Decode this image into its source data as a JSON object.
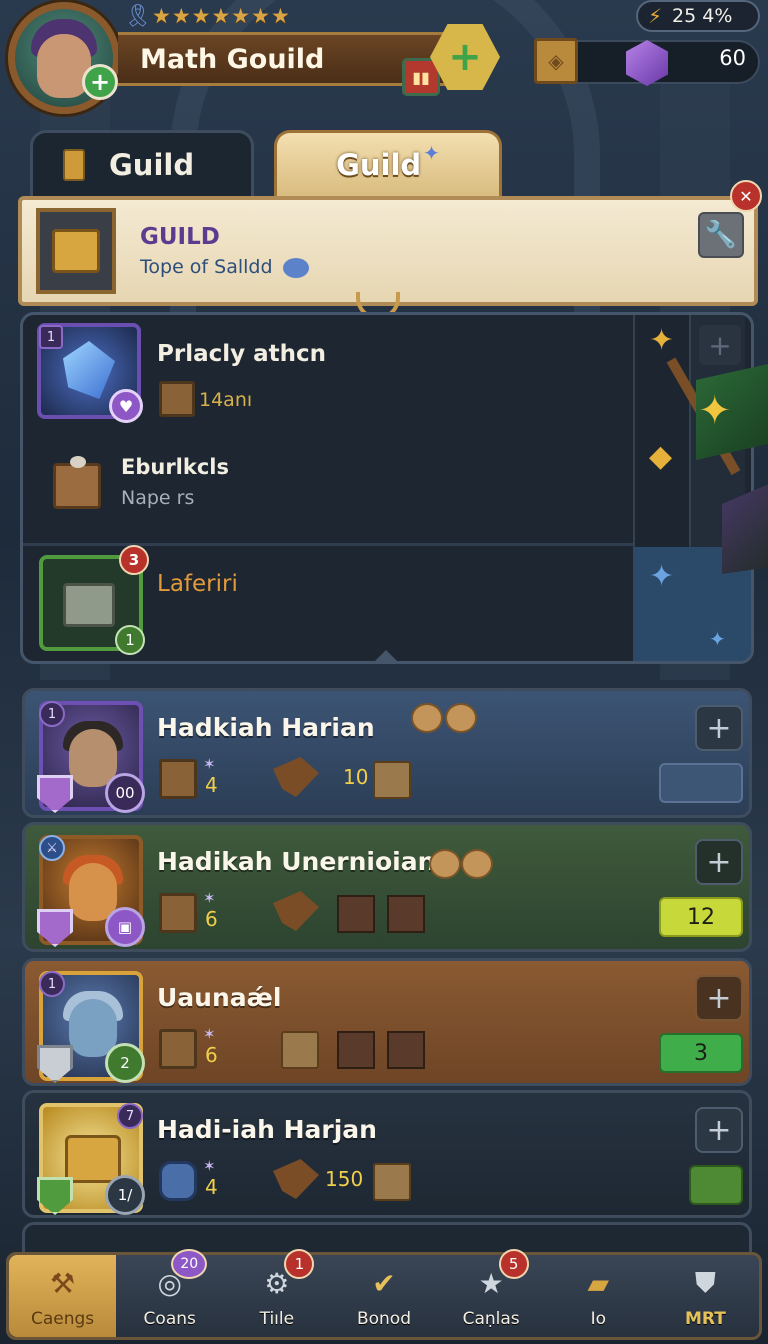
{
  "header": {
    "guild_title": "Math Gouild",
    "stars": "★★★★★★★",
    "timer": "25 4%",
    "gems": "60"
  },
  "tabs": [
    {
      "label": "Guild",
      "active": false
    },
    {
      "label": "Guild",
      "active": true
    }
  ],
  "banner": {
    "title": "GUILD",
    "subtitle": "Tope of Salldd"
  },
  "quests": [
    {
      "title": "Prlacly athcn",
      "sub": "14anı",
      "rank": "1"
    },
    {
      "title": "Eburlkcls",
      "sub": "Nape rs"
    },
    {
      "title": "Laferiri",
      "badge": "3",
      "level": "1"
    }
  ],
  "members": [
    {
      "name": "Hadkiah Harian",
      "rank": "1",
      "level": "00",
      "stat": "4",
      "tool_value": "10",
      "score": ""
    },
    {
      "name": "Hadikah Unernioiane",
      "rank": "",
      "level": "",
      "stat": "6",
      "tool_value": "",
      "score": "12",
      "score_color": "#c7d93a"
    },
    {
      "name": "Uaunaǽl",
      "rank": "1",
      "level": "2",
      "stat": "6",
      "tool_value": "",
      "score": "3",
      "score_color": "#3fae4a"
    },
    {
      "name": "Hadi-iah Harjan",
      "rank": "7",
      "level": "1/",
      "stat": "4",
      "tool_value": "150",
      "score": "",
      "score_color": "#4e8a33"
    }
  ],
  "nav": [
    {
      "label": "Caengs",
      "icon": "hammer-icon",
      "active": true
    },
    {
      "label": "Coans",
      "icon": "coin-icon",
      "badge": "20"
    },
    {
      "label": "Tiıle",
      "icon": "anvil-icon",
      "badge": "1"
    },
    {
      "label": "Bonod",
      "icon": "check-badge-icon"
    },
    {
      "label": "Caṇlas",
      "icon": "star-icon",
      "badge": "5"
    },
    {
      "label": "Io",
      "icon": "crate-icon"
    },
    {
      "label": "MRT",
      "icon": "armor-icon"
    }
  ]
}
